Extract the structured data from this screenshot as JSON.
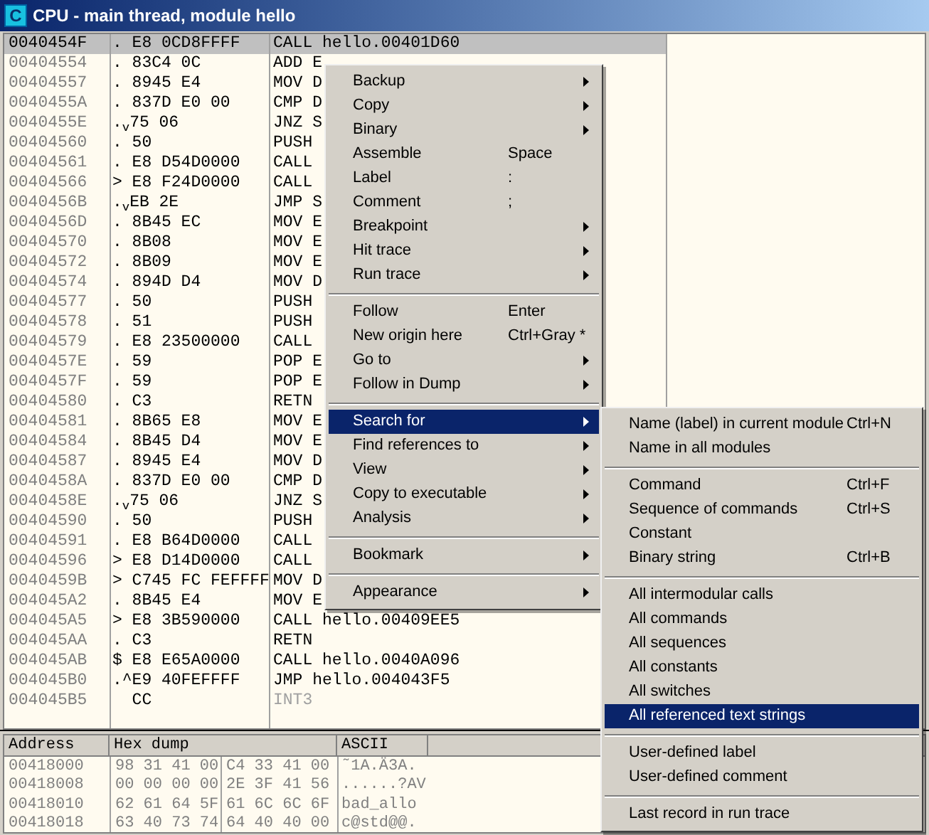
{
  "window": {
    "icon_letter": "C",
    "title": "CPU - main thread, module hello"
  },
  "disassembly": {
    "rows": [
      {
        "address": "0040454F",
        "hex": ". E8 0CD8FFFF",
        "command": "CALL hello.00401D60",
        "selected": true,
        "dimmed": false
      },
      {
        "address": "00404554",
        "hex": ". 83C4 0C",
        "command": "ADD E",
        "selected": false,
        "dimmed": false
      },
      {
        "address": "00404557",
        "hex": ". 8945 E4",
        "command": "MOV D",
        "selected": false,
        "dimmed": false
      },
      {
        "address": "0040455A",
        "hex": ". 837D E0 00",
        "command": "CMP D",
        "selected": false,
        "dimmed": false
      },
      {
        "address": "0040455E",
        "hex": ".$_{v}$75 06",
        "command": "JNZ S",
        "selected": false,
        "dimmed": false
      },
      {
        "address": "00404560",
        "hex": ". 50",
        "command": "PUSH",
        "selected": false,
        "dimmed": false
      },
      {
        "address": "00404561",
        "hex": ". E8 D54D0000",
        "command": "CALL",
        "selected": false,
        "dimmed": false
      },
      {
        "address": "00404566",
        "hex": "> E8 F24D0000",
        "command": "CALL",
        "selected": false,
        "dimmed": false
      },
      {
        "address": "0040456B",
        "hex": ".$_{v}$EB 2E",
        "command": "JMP S",
        "selected": false,
        "dimmed": false
      },
      {
        "address": "0040456D",
        "hex": ". 8B45 EC",
        "command": "MOV E",
        "selected": false,
        "dimmed": false
      },
      {
        "address": "00404570",
        "hex": ". 8B08",
        "command": "MOV E",
        "selected": false,
        "dimmed": false
      },
      {
        "address": "00404572",
        "hex": ". 8B09",
        "command": "MOV E",
        "selected": false,
        "dimmed": false
      },
      {
        "address": "00404574",
        "hex": ". 894D D4",
        "command": "MOV D",
        "selected": false,
        "dimmed": false
      },
      {
        "address": "00404577",
        "hex": ". 50",
        "command": "PUSH",
        "selected": false,
        "dimmed": false
      },
      {
        "address": "00404578",
        "hex": ". 51",
        "command": "PUSH",
        "selected": false,
        "dimmed": false
      },
      {
        "address": "00404579",
        "hex": ". E8 23500000",
        "command": "CALL",
        "selected": false,
        "dimmed": false
      },
      {
        "address": "0040457E",
        "hex": ". 59",
        "command": "POP E",
        "selected": false,
        "dimmed": false
      },
      {
        "address": "0040457F",
        "hex": ". 59",
        "command": "POP E",
        "selected": false,
        "dimmed": false
      },
      {
        "address": "00404580",
        "hex": ". C3",
        "command": "RETN",
        "selected": false,
        "dimmed": false
      },
      {
        "address": "00404581",
        "hex": ". 8B65 E8",
        "command": "MOV E",
        "selected": false,
        "dimmed": false
      },
      {
        "address": "00404584",
        "hex": ". 8B45 D4",
        "command": "MOV E",
        "selected": false,
        "dimmed": false
      },
      {
        "address": "00404587",
        "hex": ". 8945 E4",
        "command": "MOV D",
        "selected": false,
        "dimmed": false
      },
      {
        "address": "0040458A",
        "hex": ". 837D E0 00",
        "command": "CMP D",
        "selected": false,
        "dimmed": false
      },
      {
        "address": "0040458E",
        "hex": ".$_{v}$75 06",
        "command": "JNZ S",
        "selected": false,
        "dimmed": false
      },
      {
        "address": "00404590",
        "hex": ". 50",
        "command": "PUSH",
        "selected": false,
        "dimmed": false
      },
      {
        "address": "00404591",
        "hex": ". E8 B64D0000",
        "command": "CALL",
        "selected": false,
        "dimmed": false
      },
      {
        "address": "00404596",
        "hex": "> E8 D14D0000",
        "command": "CALL",
        "selected": false,
        "dimmed": false
      },
      {
        "address": "0040459B",
        "hex": "> C745 FC FEFFFF",
        "command": "MOV D",
        "selected": false,
        "dimmed": false
      },
      {
        "address": "004045A2",
        "hex": ". 8B45 E4",
        "command": "MOV E",
        "selected": false,
        "dimmed": false
      },
      {
        "address": "004045A5",
        "hex": "> E8 3B590000",
        "command": "CALL hello.00409EE5",
        "selected": false,
        "dimmed": false
      },
      {
        "address": "004045AA",
        "hex": ". C3",
        "command": "RETN",
        "selected": false,
        "dimmed": false
      },
      {
        "address": "004045AB",
        "hex": "$ E8 E65A0000",
        "command": "CALL hello.0040A096",
        "selected": false,
        "dimmed": false
      },
      {
        "address": "004045B0",
        "hex": ".^E9 40FEFFFF",
        "command": "JMP hello.004043F5",
        "selected": false,
        "dimmed": false
      },
      {
        "address": "004045B5",
        "hex": "  CC",
        "command": "INT3",
        "selected": false,
        "dimmed": true
      }
    ]
  },
  "dump": {
    "columns": [
      "Address",
      "Hex dump",
      "ASCII"
    ],
    "rows": [
      {
        "address": "00418000",
        "bytes": [
          "98 31 41 00",
          "C4 33 41 00"
        ],
        "ascii": "˜1A.Ä3A."
      },
      {
        "address": "00418008",
        "bytes": [
          "00 00 00 00",
          "2E 3F 41 56"
        ],
        "ascii": "......?AV"
      },
      {
        "address": "00418010",
        "bytes": [
          "62 61 64 5F",
          "61 6C 6C 6F"
        ],
        "ascii": "bad_allo"
      },
      {
        "address": "00418018",
        "bytes": [
          "63 40 73 74",
          "64 40 40 00"
        ],
        "ascii": "c@std@@."
      }
    ]
  },
  "context_menu": {
    "items": [
      {
        "kind": "item",
        "label": "Backup",
        "submenu": true,
        "selected": false
      },
      {
        "kind": "item",
        "label": "Copy",
        "submenu": true,
        "selected": false
      },
      {
        "kind": "item",
        "label": "Binary",
        "submenu": true,
        "selected": false
      },
      {
        "kind": "item",
        "label": "Assemble",
        "shortcut": "Space",
        "submenu": false,
        "selected": false
      },
      {
        "kind": "item",
        "label": "Label",
        "shortcut": ":",
        "submenu": false,
        "selected": false
      },
      {
        "kind": "item",
        "label": "Comment",
        "shortcut": ";",
        "submenu": false,
        "selected": false
      },
      {
        "kind": "item",
        "label": "Breakpoint",
        "submenu": true,
        "selected": false
      },
      {
        "kind": "item",
        "label": "Hit trace",
        "submenu": true,
        "selected": false
      },
      {
        "kind": "item",
        "label": "Run trace",
        "submenu": true,
        "selected": false
      },
      {
        "kind": "separator"
      },
      {
        "kind": "item",
        "label": "Follow",
        "shortcut": "Enter",
        "submenu": false,
        "selected": false
      },
      {
        "kind": "item",
        "label": "New origin here",
        "shortcut": "Ctrl+Gray *",
        "submenu": false,
        "selected": false
      },
      {
        "kind": "item",
        "label": "Go to",
        "submenu": true,
        "selected": false
      },
      {
        "kind": "item",
        "label": "Follow in Dump",
        "submenu": true,
        "selected": false
      },
      {
        "kind": "separator"
      },
      {
        "kind": "item",
        "label": "Search for",
        "submenu": true,
        "selected": true
      },
      {
        "kind": "item",
        "label": "Find references to",
        "submenu": true,
        "selected": false
      },
      {
        "kind": "item",
        "label": "View",
        "submenu": true,
        "selected": false
      },
      {
        "kind": "item",
        "label": "Copy to executable",
        "submenu": true,
        "selected": false
      },
      {
        "kind": "item",
        "label": "Analysis",
        "submenu": true,
        "selected": false
      },
      {
        "kind": "separator"
      },
      {
        "kind": "item",
        "label": "Bookmark",
        "submenu": true,
        "selected": false
      },
      {
        "kind": "separator"
      },
      {
        "kind": "item",
        "label": "Appearance",
        "submenu": true,
        "selected": false
      }
    ]
  },
  "submenu": {
    "items": [
      {
        "kind": "item",
        "label": "Name (label) in current module",
        "shortcut": "Ctrl+N",
        "submenu": false,
        "selected": false
      },
      {
        "kind": "item",
        "label": "Name in all modules",
        "submenu": false,
        "selected": false
      },
      {
        "kind": "separator"
      },
      {
        "kind": "item",
        "label": "Command",
        "shortcut": "Ctrl+F",
        "submenu": false,
        "selected": false
      },
      {
        "kind": "item",
        "label": "Sequence of commands",
        "shortcut": "Ctrl+S",
        "submenu": false,
        "selected": false
      },
      {
        "kind": "item",
        "label": "Constant",
        "submenu": false,
        "selected": false
      },
      {
        "kind": "item",
        "label": "Binary string",
        "shortcut": "Ctrl+B",
        "submenu": false,
        "selected": false
      },
      {
        "kind": "separator"
      },
      {
        "kind": "item",
        "label": "All intermodular calls",
        "submenu": false,
        "selected": false
      },
      {
        "kind": "item",
        "label": "All commands",
        "submenu": false,
        "selected": false
      },
      {
        "kind": "item",
        "label": "All sequences",
        "submenu": false,
        "selected": false
      },
      {
        "kind": "item",
        "label": "All constants",
        "submenu": false,
        "selected": false
      },
      {
        "kind": "item",
        "label": "All switches",
        "submenu": false,
        "selected": false
      },
      {
        "kind": "item",
        "label": "All referenced text strings",
        "submenu": false,
        "selected": true
      },
      {
        "kind": "separator"
      },
      {
        "kind": "item",
        "label": "User-defined label",
        "submenu": false,
        "selected": false
      },
      {
        "kind": "item",
        "label": "User-defined comment",
        "submenu": false,
        "selected": false
      },
      {
        "kind": "separator"
      },
      {
        "kind": "item",
        "label": "Last record in run trace",
        "submenu": false,
        "selected": false
      }
    ]
  }
}
